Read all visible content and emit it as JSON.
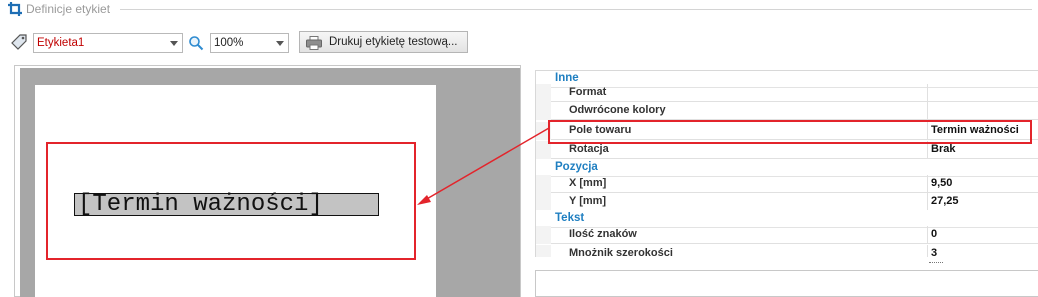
{
  "group": {
    "title": "Definicje etykiet",
    "icon": "crop-icon"
  },
  "toolbar": {
    "label_combo_value": "Etykieta1",
    "label_combo_color": "#c00000",
    "zoom_value": "100%",
    "print_button_label": "Drukuj etykietę testową..."
  },
  "designer": {
    "field_text": "[Termin ważności]"
  },
  "properties": {
    "categories": [
      {
        "name": "Inne",
        "props": [
          {
            "name": "Format",
            "value": ""
          },
          {
            "name": "Odwrócone kolory",
            "value": ""
          },
          {
            "name": "Pole towaru",
            "value": "Termin ważności"
          },
          {
            "name": "Rotacja",
            "value": "Brak"
          }
        ]
      },
      {
        "name": "Pozycja",
        "props": [
          {
            "name": "X [mm]",
            "value": "9,50"
          },
          {
            "name": "Y [mm]",
            "value": "27,25"
          }
        ]
      },
      {
        "name": "Tekst",
        "props": [
          {
            "name": "Ilość znaków",
            "value": "0"
          },
          {
            "name": "Mnożnik szerokości",
            "value": "3"
          }
        ]
      }
    ]
  },
  "colors": {
    "highlight": "#e3242b",
    "category_text": "#1f7fc1"
  }
}
